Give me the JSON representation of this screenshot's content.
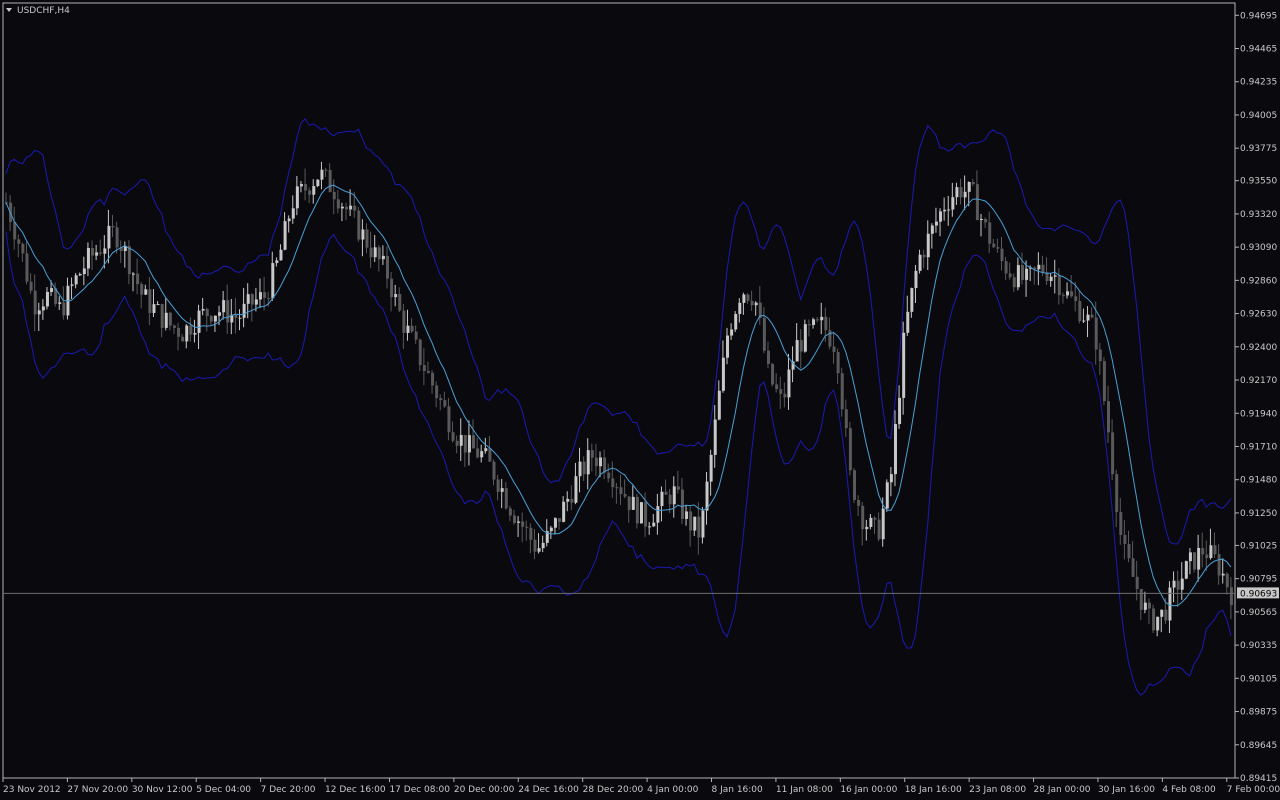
{
  "window": {
    "symbol_label": "USDCHF,H4",
    "menu_icon": "triangle-down-icon"
  },
  "colors": {
    "background": "#0a0a0e",
    "frame": "#b4b4b4",
    "text": "#c8c8c8",
    "bull_candle": "#c8c8c8",
    "bear_candle": "#5a5a5a",
    "moving_average": "#4a9fd8",
    "bands": "#1a1ab4",
    "bid_line": "#6e6e6e",
    "price_tag_bg": "#c8c8c8",
    "price_tag_text": "#000000"
  },
  "chart_data": {
    "type": "candlestick",
    "symbol": "USDCHF",
    "timeframe": "H4",
    "ylim": [
      0.89415,
      0.9478
    ],
    "y_ticks": [
      "0.94695",
      "0.94465",
      "0.94235",
      "0.94005",
      "0.93775",
      "0.93550",
      "0.93320",
      "0.93090",
      "0.92860",
      "0.92630",
      "0.92400",
      "0.92170",
      "0.91940",
      "0.91710",
      "0.91480",
      "0.91250",
      "0.91025",
      "0.90795",
      "0.90565",
      "0.90335",
      "0.90105",
      "0.89875",
      "0.89645",
      "0.89415"
    ],
    "x_ticks": [
      "23 Nov 2012",
      "27 Nov 20:00",
      "30 Nov 12:00",
      "5 Dec 04:00",
      "7 Dec 20:00",
      "12 Dec 16:00",
      "17 Dec 08:00",
      "20 Dec 00:00",
      "24 Dec 16:00",
      "28 Dec 20:00",
      "4 Jan 00:00",
      "8 Jan 16:00",
      "11 Jan 08:00",
      "16 Jan 00:00",
      "18 Jan 16:00",
      "23 Jan 08:00",
      "28 Jan 00:00",
      "30 Jan 16:00",
      "4 Feb 08:00",
      "7 Feb 00:00"
    ],
    "current_price": "0.90693",
    "close_path": [
      0.934,
      0.931,
      0.927,
      0.9275,
      0.9265,
      0.9285,
      0.93,
      0.931,
      0.932,
      0.93,
      0.9275,
      0.9265,
      0.9255,
      0.925,
      0.926,
      0.9265,
      0.9265,
      0.926,
      0.927,
      0.9275,
      0.93,
      0.934,
      0.935,
      0.936,
      0.935,
      0.9335,
      0.932,
      0.9305,
      0.929,
      0.926,
      0.924,
      0.922,
      0.92,
      0.918,
      0.917,
      0.9165,
      0.915,
      0.913,
      0.9115,
      0.91,
      0.911,
      0.913,
      0.915,
      0.9165,
      0.916,
      0.9145,
      0.913,
      0.912,
      0.913,
      0.914,
      0.912,
      0.911,
      0.918,
      0.925,
      0.928,
      0.9275,
      0.922,
      0.92,
      0.924,
      0.925,
      0.9255,
      0.924,
      0.915,
      0.912,
      0.911,
      0.915,
      0.925,
      0.93,
      0.932,
      0.934,
      0.935,
      0.9345,
      0.932,
      0.93,
      0.929,
      0.9285,
      0.9295,
      0.929,
      0.9275,
      0.9265,
      0.925,
      0.918,
      0.91,
      0.9075,
      0.905,
      0.9055,
      0.9075,
      0.909,
      0.91,
      0.909,
      0.907
    ],
    "moving_average": "solid light-blue line following price",
    "bands": "upper and lower envelope lines in dark blue"
  }
}
